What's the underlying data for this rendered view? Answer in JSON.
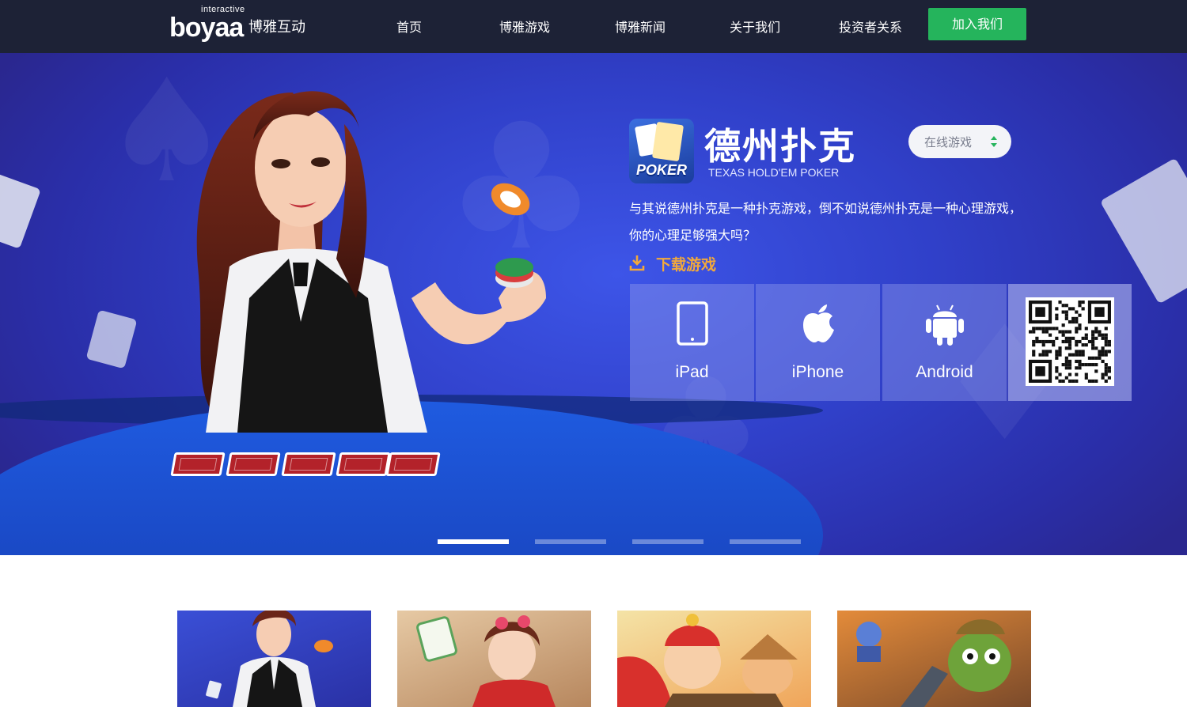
{
  "header": {
    "logo": {
      "small": "interactive",
      "brand": "boyaa",
      "brand_cn": "博雅互动"
    },
    "nav": [
      {
        "label": "首页"
      },
      {
        "label": "博雅游戏"
      },
      {
        "label": "博雅新闻"
      },
      {
        "label": "关于我们"
      },
      {
        "label": "投资者关系"
      }
    ],
    "join_label": "加入我们"
  },
  "hero": {
    "game": {
      "icon_text": "POKER",
      "title": "德州扑克",
      "subtitle": "TEXAS HOLD'EM POKER",
      "select_value": "在线游戏",
      "desc_line1": "与其说德州扑克是一种扑克游戏，倒不如说德州扑克是一种心理游戏，",
      "desc_line2": "你的心理足够强大吗？",
      "download_label": "下载游戏"
    },
    "platforms": [
      {
        "label": "iPad",
        "icon": "ipad-icon"
      },
      {
        "label": "iPhone",
        "icon": "apple-icon"
      },
      {
        "label": "Android",
        "icon": "android-icon"
      }
    ],
    "qr_icon": "qr-code",
    "slides_total": 4,
    "slide_active": 1
  },
  "colors": {
    "header_bg": "#1d2236",
    "join_green": "#25b45c",
    "hero_blue": "#3040c9",
    "download_orange": "#f2a93b"
  },
  "thumbnails": [
    {
      "name": "texas-poker-thumb"
    },
    {
      "name": "mahjong-thumb"
    },
    {
      "name": "landlord-thumb"
    },
    {
      "name": "adventure-thumb"
    }
  ]
}
